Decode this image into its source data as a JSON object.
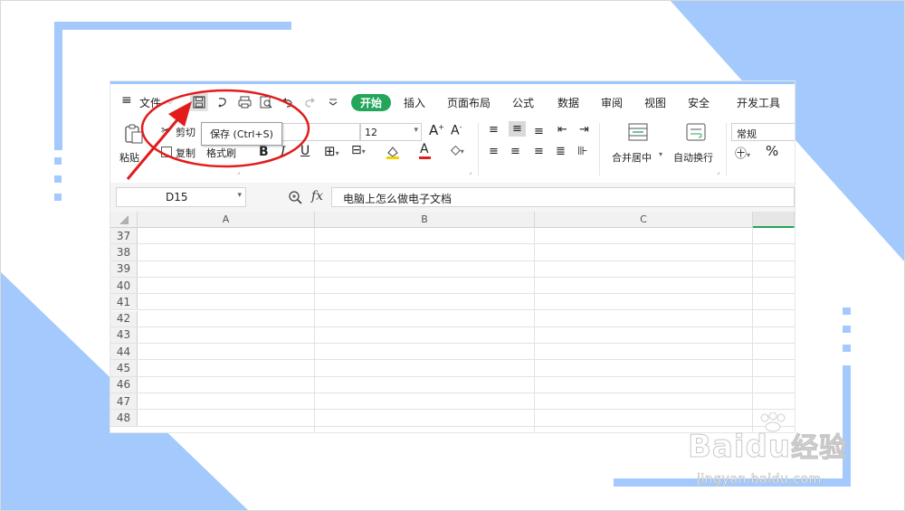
{
  "menu": {
    "file_label": "文件",
    "tabs": [
      {
        "label": "开始",
        "active": true
      },
      {
        "label": "插入"
      },
      {
        "label": "页面布局"
      },
      {
        "label": "公式"
      },
      {
        "label": "数据"
      },
      {
        "label": "审阅"
      },
      {
        "label": "视图"
      },
      {
        "label": "安全"
      },
      {
        "label": "开发工具"
      }
    ]
  },
  "ribbon": {
    "paste": "粘贴",
    "cut": "剪切",
    "copy": "复制",
    "format_painter": "格式刷",
    "font_size": "12",
    "merge_center": "合并居中",
    "wrap_text": "自动换行",
    "number_format": "常规",
    "percent": "%"
  },
  "tooltip": {
    "text": "保存 (Ctrl+S)"
  },
  "formula_bar": {
    "cell_ref": "D15",
    "fx": "fx",
    "content": "电脑上怎么做电子文档"
  },
  "columns": [
    "A",
    "B",
    "C"
  ],
  "rows": [
    "37",
    "38",
    "39",
    "40",
    "41",
    "42",
    "43",
    "44",
    "45",
    "46",
    "47",
    "48"
  ],
  "watermark": {
    "brand_latin": "Bai",
    "brand_du": "du",
    "brand_cn": "经验",
    "url": "jingyan.baidu.com"
  },
  "colors": {
    "accent_green": "#23a55a",
    "frame_blue": "#9ec6ff",
    "annotation_red": "#e21b1b"
  }
}
